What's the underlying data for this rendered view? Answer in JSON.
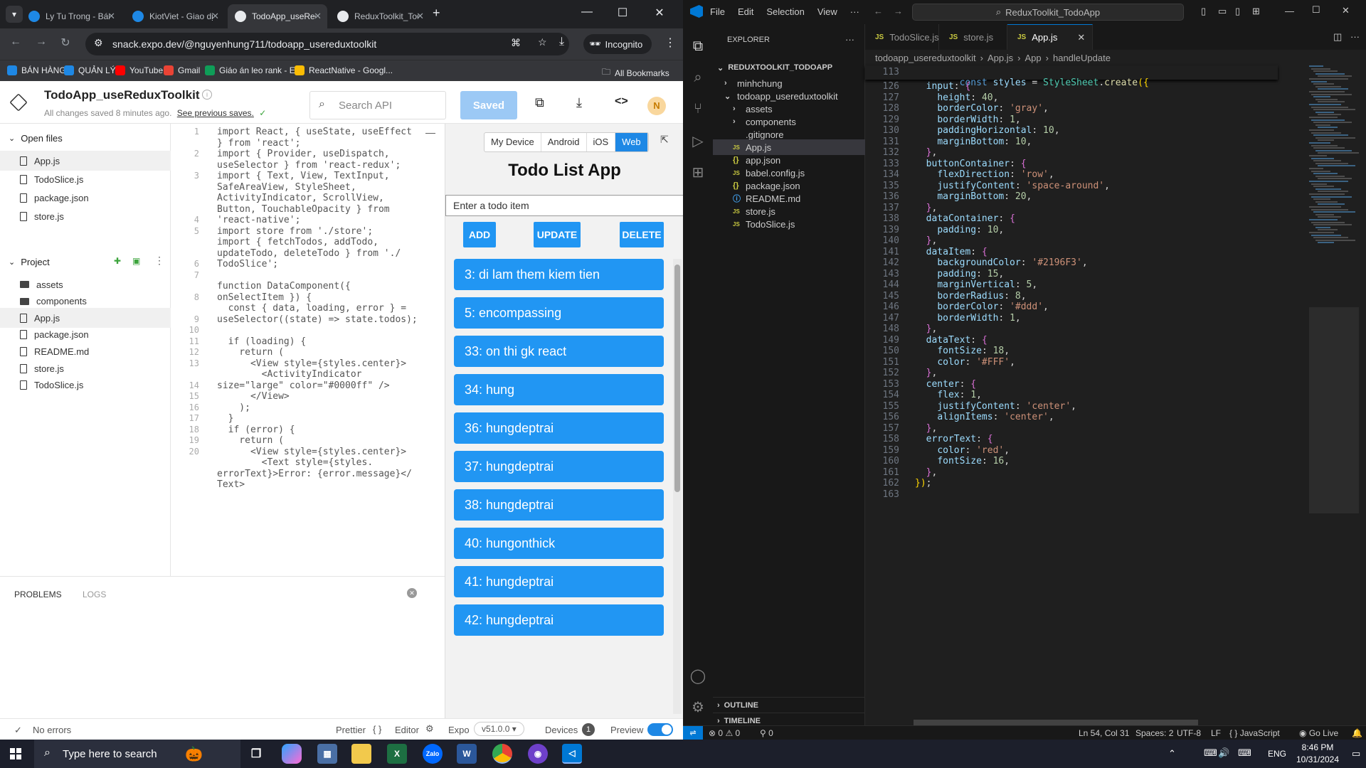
{
  "chrome": {
    "tabs": [
      {
        "title": "Ly Tu Trong - Bán h",
        "fav_color": "#1e88e5",
        "active": false
      },
      {
        "title": "KiotViet - Giao dịch",
        "fav_color": "#1e88e5",
        "active": false
      },
      {
        "title": "TodoApp_useRedux",
        "fav_color": "#e8eaed",
        "active": true
      },
      {
        "title": "ReduxToolkit_Todo",
        "fav_color": "#e8eaed",
        "active": false
      }
    ],
    "new_tab": "+",
    "url": "snack.expo.dev/@nguyenhung711/todoapp_usereduxtoolkit",
    "incognito_label": "Incognito",
    "bookmarks": [
      {
        "label": "BÁN HÀNG",
        "color": "#1e88e5"
      },
      {
        "label": "QUẢN LÝ",
        "color": "#1e88e5"
      },
      {
        "label": "YouTube",
        "color": "#ff0000"
      },
      {
        "label": "Gmail",
        "color": "#ea4335"
      },
      {
        "label": "Giáo án leo rank - E...",
        "color": "#0f9d58"
      },
      {
        "label": "ReactNative - Googl...",
        "color": "#fbbc04"
      }
    ],
    "all_bookmarks": "All Bookmarks"
  },
  "snack": {
    "project_title": "TodoApp_useReduxToolkit",
    "save_status": "All changes saved 8 minutes ago.",
    "see_previous": "See previous saves.",
    "search_placeholder": "Search API",
    "saved_button": "Saved",
    "avatar_letter": "N",
    "open_files_label": "Open files",
    "open_files": [
      "App.js",
      "TodoSlice.js",
      "package.json",
      "store.js"
    ],
    "project_label": "Project",
    "project_files": [
      "assets",
      "components",
      "App.js",
      "package.json",
      "README.md",
      "store.js",
      "TodoSlice.js"
    ],
    "problems_tab": "PROBLEMS",
    "logs_tab": "LOGS",
    "footer": {
      "no_errors": "No errors",
      "prettier": "Prettier",
      "editor": "Editor",
      "expo": "Expo",
      "version": "v51.0.0 ▾",
      "devices": "Devices",
      "devices_count": "1",
      "preview": "Preview"
    },
    "preview_tabs": [
      "My Device",
      "Android",
      "iOS",
      "Web"
    ],
    "preview_active_tab": "Web",
    "app": {
      "title": "Todo List App",
      "input_placeholder": "Enter a todo item",
      "add_button": "ADD",
      "update_button": "UPDATE",
      "delete_button": "DELETE",
      "todos": [
        "3: di lam them kiem tien",
        "5: encompassing",
        "33: on thi gk react",
        "34: hung",
        "36: hungdeptrai",
        "37: hungdeptrai",
        "38: hungdeptrai",
        "40: hungonthick",
        "41: hungdeptrai",
        "42: hungdeptrai"
      ]
    },
    "code_line_numbers": [
      "1",
      "",
      "2",
      "",
      "3",
      "",
      "",
      "",
      "4",
      "5",
      "",
      "",
      "6",
      "7",
      "",
      "8",
      "",
      "9",
      "10",
      "11",
      "12",
      "13",
      "",
      "14",
      "15",
      "16",
      "17",
      "18",
      "19",
      "20",
      "",
      ""
    ],
    "code_lines": [
      "import React, { useState, useEffect",
      "} from 'react';",
      "import { Provider, useDispatch,",
      "useSelector } from 'react-redux';",
      "import { Text, View, TextInput,",
      "SafeAreaView, StyleSheet,",
      "ActivityIndicator, ScrollView,",
      "Button, TouchableOpacity } from",
      "'react-native';",
      "import store from './store';",
      "import { fetchTodos, addTodo,",
      "updateTodo, deleteTodo } from './",
      "TodoSlice';",
      "",
      "function DataComponent({",
      "onSelectItem }) {",
      "  const { data, loading, error } =",
      "useSelector((state) => state.todos);",
      "",
      "  if (loading) {",
      "    return (",
      "      <View style={styles.center}>",
      "        <ActivityIndicator",
      "size=\"large\" color=\"#0000ff\" />",
      "      </View>",
      "    );",
      "  }",
      "  if (error) {",
      "    return (",
      "      <View style={styles.center}>",
      "        <Text style={styles.",
      "errorText}>Error: {error.message}</",
      "Text>"
    ]
  },
  "vscode": {
    "menu": [
      "File",
      "Edit",
      "Selection",
      "View",
      "···"
    ],
    "search_title": "ReduxToolkit_TodoApp",
    "explorer_label": "EXPLORER",
    "explorer_more": "···",
    "root_folder": "REDUXTOOLKIT_TODOAPP",
    "tree": [
      {
        "label": "minhchung",
        "indent": 1,
        "type": "folder-closed"
      },
      {
        "label": "todoapp_usereduxtoolkit",
        "indent": 1,
        "type": "folder-open"
      },
      {
        "label": "assets",
        "indent": 2,
        "type": "folder-closed"
      },
      {
        "label": "components",
        "indent": 2,
        "type": "folder-closed"
      },
      {
        "label": ".gitignore",
        "indent": 2,
        "type": "file"
      },
      {
        "label": "App.js",
        "indent": 2,
        "type": "js"
      },
      {
        "label": "app.json",
        "indent": 2,
        "type": "json"
      },
      {
        "label": "babel.config.js",
        "indent": 2,
        "type": "js"
      },
      {
        "label": "package.json",
        "indent": 2,
        "type": "json"
      },
      {
        "label": "README.md",
        "indent": 2,
        "type": "md"
      },
      {
        "label": "store.js",
        "indent": 2,
        "type": "js"
      },
      {
        "label": "TodoSlice.js",
        "indent": 2,
        "type": "js"
      }
    ],
    "outline_label": "OUTLINE",
    "timeline_label": "TIMELINE",
    "tabs": [
      {
        "label": "TodoSlice.js",
        "active": false
      },
      {
        "label": "store.js",
        "active": false
      },
      {
        "label": "App.js",
        "active": true
      }
    ],
    "breadcrumb": [
      "todoapp_usereduxtoolkit",
      "App.js",
      "App",
      "handleUpdate"
    ],
    "sticky_line": {
      "num": "113",
      "text": "const styles = StyleSheet.create({"
    },
    "line_numbers": [
      "126",
      "127",
      "128",
      "129",
      "130",
      "131",
      "132",
      "133",
      "134",
      "135",
      "136",
      "137",
      "138",
      "139",
      "140",
      "141",
      "142",
      "143",
      "144",
      "145",
      "146",
      "147",
      "148",
      "149",
      "150",
      "151",
      "152",
      "153",
      "154",
      "155",
      "156",
      "157",
      "158",
      "159",
      "160",
      "161",
      "162",
      "163"
    ],
    "lines": [
      "  input: {",
      "    height: 40,",
      "    borderColor: 'gray',",
      "    borderWidth: 1,",
      "    paddingHorizontal: 10,",
      "    marginBottom: 10,",
      "  },",
      "  buttonContainer: {",
      "    flexDirection: 'row',",
      "    justifyContent: 'space-around',",
      "    marginBottom: 20,",
      "  },",
      "  dataContainer: {",
      "    padding: 10,",
      "  },",
      "  dataItem: {",
      "    backgroundColor: '#2196F3',",
      "    padding: 15,",
      "    marginVertical: 5,",
      "    borderRadius: 8,",
      "    borderColor: '#ddd',",
      "    borderWidth: 1,",
      "  },",
      "  dataText: {",
      "    fontSize: 18,",
      "    color: '#FFF',",
      "  },",
      "  center: {",
      "    flex: 1,",
      "    justifyContent: 'center',",
      "    alignItems: 'center',",
      "  },",
      "  errorText: {",
      "    color: 'red',",
      "    fontSize: 16,",
      "  },",
      "});",
      ""
    ],
    "status": {
      "errors": "0",
      "warnings": "0",
      "ports": "0",
      "position": "Ln 54, Col 31",
      "spaces": "Spaces: 2",
      "encoding": "UTF-8",
      "eol": "LF",
      "language": "JavaScript",
      "golive": "Go Live"
    }
  },
  "taskbar": {
    "search_placeholder": "Type here to search",
    "lang": "ENG",
    "time": "8:46 PM",
    "date": "10/31/2024"
  },
  "colors": {
    "accent": "#2196F3",
    "vscode_blue": "#0078d4",
    "snack_saved": "#9cc9f5"
  }
}
